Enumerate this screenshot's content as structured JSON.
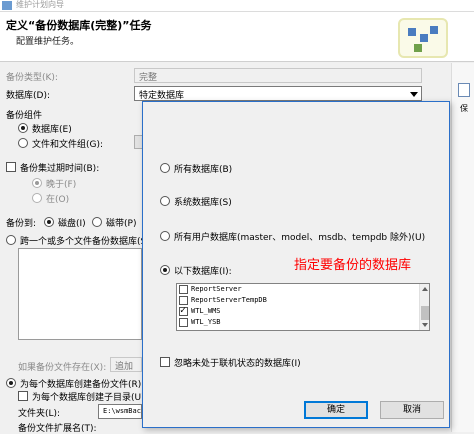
{
  "window": {
    "title": "维护计划向导"
  },
  "header": {
    "title": "定义“备份数据库(完整)”任务",
    "subtitle": "配置维护任务。"
  },
  "form": {
    "backup_type_label": "备份类型(K):",
    "backup_type_value": "完整",
    "database_label": "数据库(D):",
    "database_value": "特定数据库",
    "component_label": "备份组件",
    "component_database": "数据库(E)",
    "component_files": "文件和文件组(G):",
    "expire_label": "备份集过期时间(B):",
    "expire_after": "晚于(F)",
    "expire_on": "在(O)",
    "backup_to_label": "备份到:",
    "backup_to_disk": "磁盘(I)",
    "backup_to_tape": "磁带(P)",
    "across_files": "跨一个或多个文件备份数据库(S",
    "if_exists_label": "如果备份文件存在(X):",
    "if_exists_value": "追加",
    "per_db_file": "为每个数据库创建备份文件(R)",
    "per_db_subdir": "为每个数据库创建子目录(U)",
    "folder_label": "文件夹(L):",
    "folder_value": "E:\\wsmBac",
    "ext_label": "备份文件扩展名(T):"
  },
  "dialog": {
    "options": {
      "all": "所有数据库(B)",
      "system": "系统数据库(S)",
      "user": "所有用户数据库(master、model、msdb、tempdb 除外)(U)",
      "these": "以下数据库(I):"
    },
    "selected_option": "these",
    "databases": [
      {
        "name": "ReportServer",
        "checked": false
      },
      {
        "name": "ReportServerTempDB",
        "checked": false
      },
      {
        "name": "WTL_WMS",
        "checked": true
      },
      {
        "name": "WTL_YSB",
        "checked": false
      }
    ],
    "ignore_offline": "忽略未处于联机状态的数据库(I)",
    "ok_label": "确定",
    "cancel_label": "取消"
  },
  "annotation": {
    "text": "指定要备份的数据库"
  },
  "colors": {
    "annotation": "#ff0000",
    "dialog_border": "#2a6fc9",
    "focus": "#0078d7"
  }
}
